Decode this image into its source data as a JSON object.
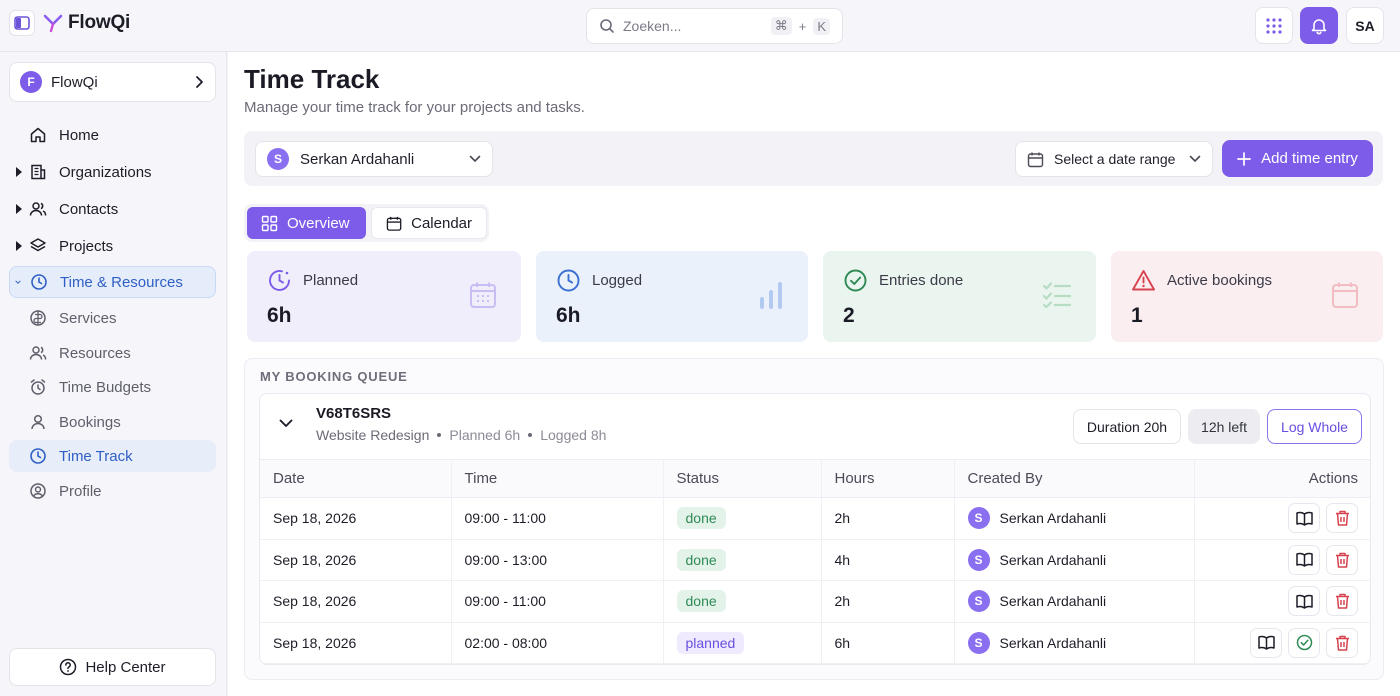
{
  "app": {
    "name": "FlowQi",
    "user_initials": "SA"
  },
  "search": {
    "placeholder": "Zoeken...",
    "shortcut_key1": "⌘",
    "shortcut_plus": "+",
    "shortcut_key2": "K"
  },
  "sidebar": {
    "org": {
      "initial": "F",
      "name": "FlowQi"
    },
    "items": [
      {
        "label": "Home",
        "icon": "home-icon"
      },
      {
        "label": "Organizations",
        "icon": "building-icon"
      },
      {
        "label": "Contacts",
        "icon": "users-icon"
      },
      {
        "label": "Projects",
        "icon": "layers-icon"
      },
      {
        "label": "Time & Resources",
        "icon": "clock-icon"
      },
      {
        "label": "Services",
        "icon": "services-icon"
      },
      {
        "label": "Resources",
        "icon": "users-icon"
      },
      {
        "label": "Time Budgets",
        "icon": "alarm-icon"
      },
      {
        "label": "Bookings",
        "icon": "user-icon"
      },
      {
        "label": "Time Track",
        "icon": "clock-icon"
      },
      {
        "label": "Profile",
        "icon": "profile-icon"
      }
    ],
    "help": "Help Center"
  },
  "page": {
    "title": "Time Track",
    "subtitle": "Manage your time track for your projects and tasks."
  },
  "filters": {
    "user_initial": "S",
    "user": "Serkan Ardahanli",
    "date_range": "Select a date range",
    "add_button": "Add time entry"
  },
  "tabs": [
    {
      "label": "Overview"
    },
    {
      "label": "Calendar"
    }
  ],
  "stats": [
    {
      "label": "Planned",
      "value": "6h",
      "color": "#7c5ce8"
    },
    {
      "label": "Logged",
      "value": "6h",
      "color": "#3b6fd1"
    },
    {
      "label": "Entries done",
      "value": "2",
      "color": "#2f8a55"
    },
    {
      "label": "Active bookings",
      "value": "1",
      "color": "#d6434f"
    }
  ],
  "queue": {
    "title": "MY BOOKING QUEUE",
    "booking": {
      "code": "V68T6SRS",
      "project": "Website Redesign",
      "planned": "Planned 6h",
      "logged": "Logged 8h",
      "duration": "Duration 20h",
      "left": "12h left",
      "log_whole": "Log Whole"
    },
    "columns": [
      "Date",
      "Time",
      "Status",
      "Hours",
      "Created By",
      "Actions"
    ],
    "rows": [
      {
        "date": "Sep 18, 2026",
        "time": "09:00 - 11:00",
        "status": "done",
        "hours": "2h",
        "creator_initial": "S",
        "created_by": "Serkan Ardahanli"
      },
      {
        "date": "Sep 18, 2026",
        "time": "09:00 - 13:00",
        "status": "done",
        "hours": "4h",
        "creator_initial": "S",
        "created_by": "Serkan Ardahanli"
      },
      {
        "date": "Sep 18, 2026",
        "time": "09:00 - 11:00",
        "status": "done",
        "hours": "2h",
        "creator_initial": "S",
        "created_by": "Serkan Ardahanli"
      },
      {
        "date": "Sep 18, 2026",
        "time": "02:00 - 08:00",
        "status": "planned",
        "hours": "6h",
        "creator_initial": "S",
        "created_by": "Serkan Ardahanli"
      }
    ]
  },
  "colors": {
    "accent": "#7c5ce8",
    "active_nav": "#2f5fc5",
    "done": "#2f8a55",
    "danger": "#d6434f"
  }
}
